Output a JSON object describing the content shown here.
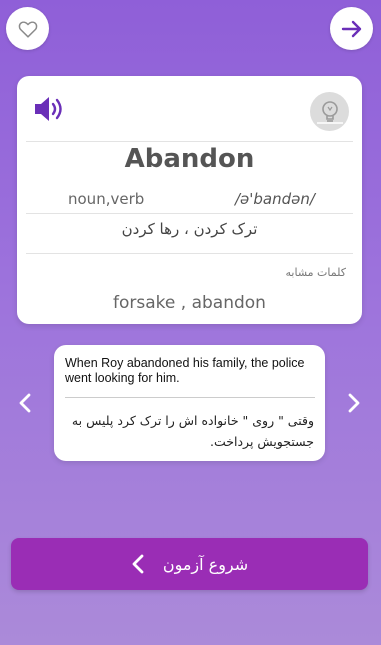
{
  "colors": {
    "background_top": "#8f5fd8",
    "accent_purple": "#6a2fb8",
    "quiz_button": "#9a2db5",
    "card": "#ffffff"
  },
  "header": {
    "favorite_icon": "heart-outline-icon",
    "next_icon": "arrow-right-icon"
  },
  "word_card": {
    "speaker_icon": "speaker-icon",
    "hint_icon": "lightbulb-icon",
    "word": "Abandon",
    "part_of_speech": "noun,verb",
    "phonetic": "/ə'bandən/",
    "meaning": "ترک کردن ، رها کردن",
    "similar_label": "کلمات مشابه",
    "similar_words": "forsake , abandon"
  },
  "example": {
    "english": "When Roy abandoned his family, the police went looking for him.",
    "persian": "وقتی \" روی \" خانواده اش را ترک کرد پلیس به جستجویش پرداخت."
  },
  "navigation": {
    "prev_icon": "chevron-left-icon",
    "next_icon": "chevron-right-icon"
  },
  "quiz_button": {
    "label": "شروع آزمون",
    "icon": "chevron-left-icon"
  }
}
